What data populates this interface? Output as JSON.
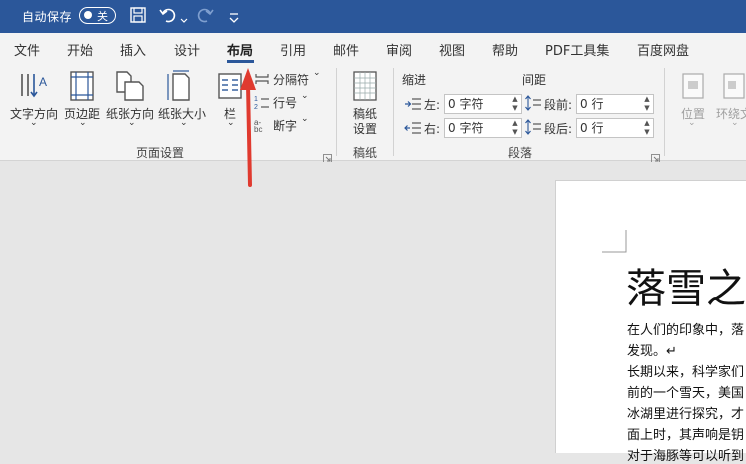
{
  "titlebar": {
    "autosave_label": "自动保存",
    "toggle_label": "关",
    "icons": [
      "save-icon",
      "undo-icon",
      "redo-icon",
      "customize-icon"
    ]
  },
  "menu": {
    "tabs": [
      "文件",
      "开始",
      "插入",
      "设计",
      "布局",
      "引用",
      "邮件",
      "审阅",
      "视图",
      "帮助",
      "PDF工具集",
      "百度网盘"
    ],
    "active": "布局"
  },
  "ribbon": {
    "page_setup": {
      "text_direction": "文字方向",
      "margins": "页边距",
      "orientation": "纸张方向",
      "size": "纸张大小",
      "columns": "栏",
      "breaks": "分隔符",
      "line_numbers": "行号",
      "hyphenation": "断字",
      "group_label": "页面设置"
    },
    "manuscript": {
      "button_line1": "稿纸",
      "button_line2": "设置",
      "group_label": "稿纸"
    },
    "paragraph": {
      "indent_header": "缩进",
      "spacing_header": "间距",
      "left_label": "左:",
      "right_label": "右:",
      "before_label": "段前:",
      "after_label": "段后:",
      "left_value": "0 字符",
      "right_value": "0 字符",
      "before_value": "0 行",
      "after_value": "0 行",
      "group_label": "段落"
    },
    "arrange": {
      "position": "位置",
      "wrap_text": "环绕文"
    }
  },
  "document": {
    "title": "落雪之",
    "lines": [
      "在人们的印象中，落",
      "发现。↵",
      "长期以来，科学家们",
      "前的一个雪天，美国",
      "冰湖里进行探究，才",
      "面上时，其声响是钥",
      "对于海豚等可以听到"
    ]
  },
  "colors": {
    "titlebar": "#2b579a",
    "ribbon": "#f3f3f3",
    "canvas": "#e6e6e6",
    "annotation_arrow": "#e03a2f"
  }
}
